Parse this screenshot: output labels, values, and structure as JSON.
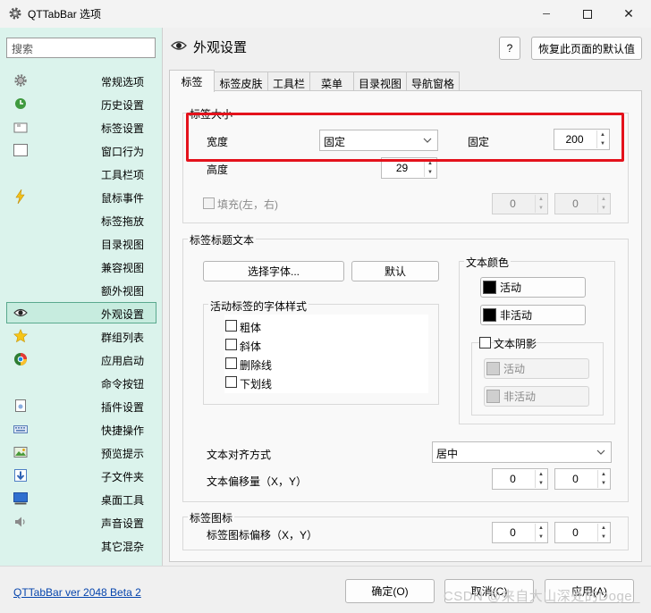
{
  "window": {
    "title": "QTTabBar 选项",
    "minimize_glyph": "─",
    "close_glyph": "✕"
  },
  "colors": {
    "sidebar_bg": "#dbf3ec",
    "selected_bg": "#c7ecdf",
    "accent_red": "#e4121c",
    "link": "#0645ad"
  },
  "sidebar": {
    "search_placeholder": "搜索",
    "items": [
      {
        "label": "常规选项",
        "icon": "gear-icon"
      },
      {
        "label": "历史设置",
        "icon": "history-icon"
      },
      {
        "label": "标签设置",
        "icon": "tab-icon"
      },
      {
        "label": "窗口行为",
        "icon": "window-icon"
      },
      {
        "label": "工具栏项",
        "icon": ""
      },
      {
        "label": "鼠标事件",
        "icon": "lightning-icon"
      },
      {
        "label": "标签拖放",
        "icon": ""
      },
      {
        "label": "目录视图",
        "icon": ""
      },
      {
        "label": "兼容视图",
        "icon": ""
      },
      {
        "label": "额外视图",
        "icon": ""
      },
      {
        "label": "外观设置",
        "icon": "eye-icon"
      },
      {
        "label": "群组列表",
        "icon": "star-icon"
      },
      {
        "label": "应用启动",
        "icon": "app-launch-icon"
      },
      {
        "label": "命令按钮",
        "icon": ""
      },
      {
        "label": "插件设置",
        "icon": "plugin-icon"
      },
      {
        "label": "快捷操作",
        "icon": "keyboard-icon"
      },
      {
        "label": "预览提示",
        "icon": "preview-icon"
      },
      {
        "label": "子文件夹",
        "icon": "subfolder-icon"
      },
      {
        "label": "桌面工具",
        "icon": "desktop-icon"
      },
      {
        "label": "声音设置",
        "icon": "speaker-icon"
      },
      {
        "label": "其它混杂",
        "icon": ""
      }
    ]
  },
  "header": {
    "title": "外观设置",
    "help_label": "?",
    "restore_label": "恢复此页面的默认值"
  },
  "tabs": [
    "标签",
    "标签皮肤",
    "工具栏",
    "菜单",
    "目录视图",
    "导航窗格"
  ],
  "tab_size": {
    "title": "标签大小",
    "width_label": "宽度",
    "width_mode": "固定",
    "fixed_label": "固定",
    "fixed_value": "200",
    "height_label": "高度",
    "height_value": "29",
    "fill_label": "填充(左，右)",
    "fill_left": "0",
    "fill_right": "0"
  },
  "title_text": {
    "title": "标签标题文本",
    "choose_font_label": "选择字体...",
    "default_label": "默认",
    "font_style_title": "活动标签的字体样式",
    "styles": [
      "粗体",
      "斜体",
      "删除线",
      "下划线"
    ],
    "text_color_title": "文本颜色",
    "active_label": "活动",
    "inactive_label": "非活动",
    "shadow_label": "文本阴影",
    "shadow_active_label": "活动",
    "shadow_inactive_label": "非活动",
    "align_label": "文本对齐方式",
    "align_value": "居中",
    "offset_label": "文本偏移量（X，Y）",
    "offset_x": "0",
    "offset_y": "0"
  },
  "tab_icon": {
    "title": "标签图标",
    "offset_label": "标签图标偏移（X，Y）",
    "offset_x": "0",
    "offset_y": "0"
  },
  "footer": {
    "version": "QTTabBar ver 2048 Beta 2",
    "ok_label": "确定(O)",
    "cancel_label": "取消(C)",
    "apply_label": "应用(A)",
    "watermark": "CSDN @来自大山深处的Doge_"
  }
}
